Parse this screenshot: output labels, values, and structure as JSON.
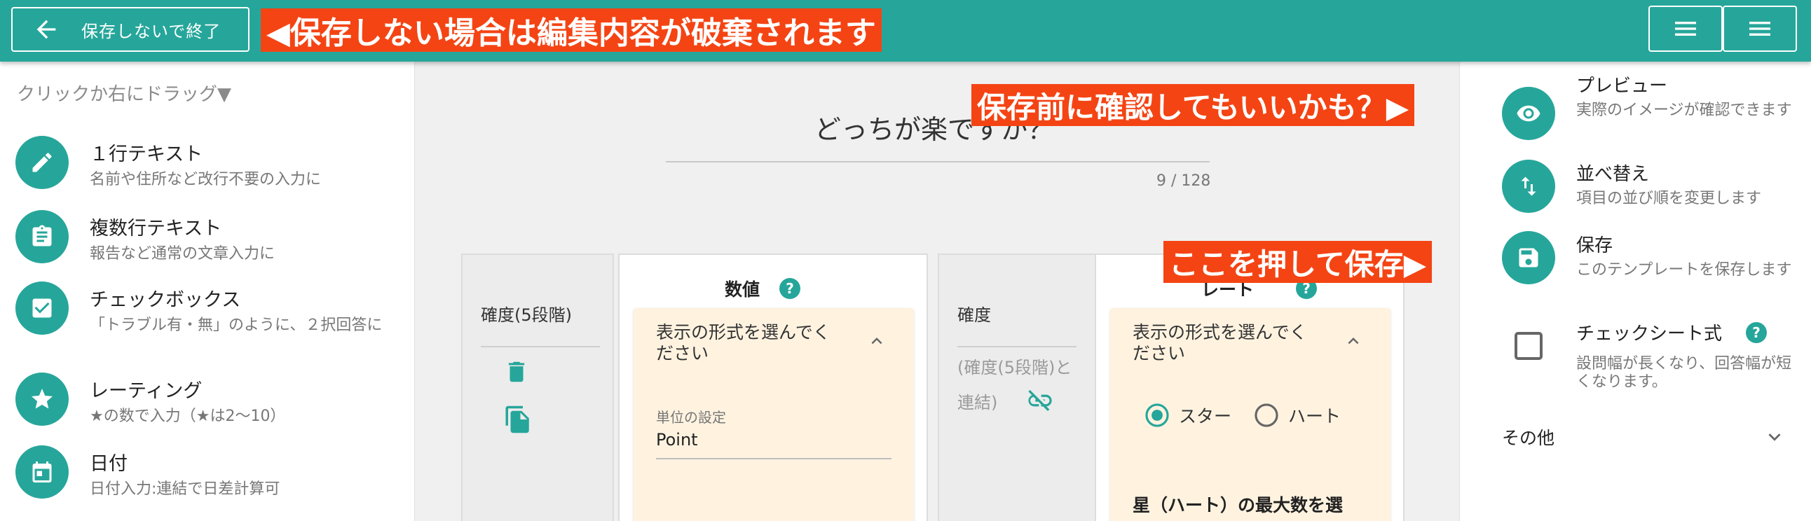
{
  "header": {
    "exit_label": "保存しないで終了"
  },
  "callouts": {
    "exit_note": "◀保存しない場合は編集内容が破棄されます",
    "preview_note": "保存前に確認してもいいかも？▶",
    "save_note": "ここを押して保存▶"
  },
  "left": {
    "hint": "クリックか右にドラッグ▼",
    "items": [
      {
        "title": "１行テキスト",
        "sub": "名前や住所など改行不要の入力に"
      },
      {
        "title": "複数行テキスト",
        "sub": "報告など通常の文章入力に"
      },
      {
        "title": "チェックボックス",
        "sub": "「トラブル有・無」のように、２択回答に"
      },
      {
        "title": "レーティング",
        "sub": "★の数で入力（★は2〜10）"
      },
      {
        "title": "日付",
        "sub": "日付入力:連結で日差計算可"
      }
    ]
  },
  "center": {
    "question": "どっちが楽ですか？",
    "count": "9 / 128",
    "card1_label": "確度(5段階)",
    "card2_title": "数値",
    "select_prompt": "表示の形式を選んでください",
    "unit_label": "単位の設定",
    "unit_value": "Point",
    "card3_label": "確度",
    "card3_link": "(確度(5段階)と連結)",
    "card4_title": "レート",
    "radio_star": "スター",
    "radio_heart": "ハート",
    "max_label": "星（ハート）の最大数を選"
  },
  "right": {
    "preview_title": "プレビュー",
    "preview_sub": "実際のイメージが確認できます",
    "sort_title": "並べ替え",
    "sort_sub": "項目の並び順を変更します",
    "save_title": "保存",
    "save_sub": "このテンプレートを保存します",
    "check_title": "チェックシート式",
    "check_sub": "設問幅が長くなり、回答幅が短くなります。",
    "other": "その他"
  },
  "help_mark": "?"
}
